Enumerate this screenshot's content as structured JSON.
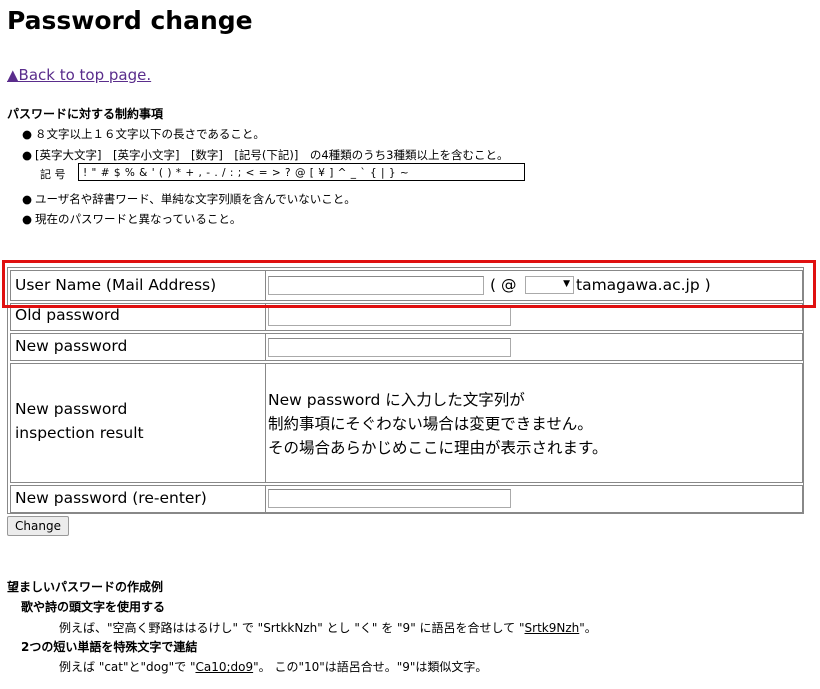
{
  "page": {
    "title": "Password change",
    "back_link": "▲Back to top page."
  },
  "rules": {
    "heading": "パスワードに対する制約事項",
    "items": [
      "８文字以上１６文字以下の長さであること。",
      "[英字大文字]　[英字小文字]　[数字]　[記号(下記)]　の4種類のうち3種類以上を含むこと。",
      "ユーザ名や辞書ワード、単純な文字列順を含んでいないこと。",
      "現在のパスワードと異なっていること。"
    ],
    "symbols_label": "記 号",
    "symbols": "! \" # $ % & ' ( ) * + , - . / : ; < = > ? @ [ ¥ ] ^ _ ` { | } ~"
  },
  "form": {
    "username_label": "User Name (Mail Address)",
    "username_value": "",
    "domain_open": "( @",
    "domain_selected": "",
    "domain_suffix": "tamagawa.ac.jp )",
    "old_password_label": "Old password",
    "new_password_label": "New password",
    "inspection_label_1": "New password",
    "inspection_label_2": "inspection result",
    "inspection_text": [
      "New password に入力した文字列が",
      "制約事項にそぐわない場合は変更できません。",
      "その場合あらかじめここに理由が表示されます。"
    ],
    "reenter_label": "New password (re-enter)",
    "change_button": "Change"
  },
  "examples": {
    "heading": "望ましいパスワードの作成例",
    "section1_title": "歌や詩の頭文字を使用する",
    "section1_pre": "例えば、\"空高く野路ははるけし\" で \"SrtkkNzh\" とし \"く\" を \"9\" に語呂を合せして \"",
    "section1_link": "Srtk9Nzh",
    "section1_post": "\"。",
    "section2_title": "2つの短い単語を特殊文字で連結",
    "section2_pre": "例えば \"cat\"と\"dog\"で \"",
    "section2_link": "Ca10;do9",
    "section2_post": "\"。 この\"10\"は語呂合せ。\"9\"は類似文字。"
  },
  "colors": {
    "highlight": "#e01010",
    "link": "#5a2d8c"
  }
}
